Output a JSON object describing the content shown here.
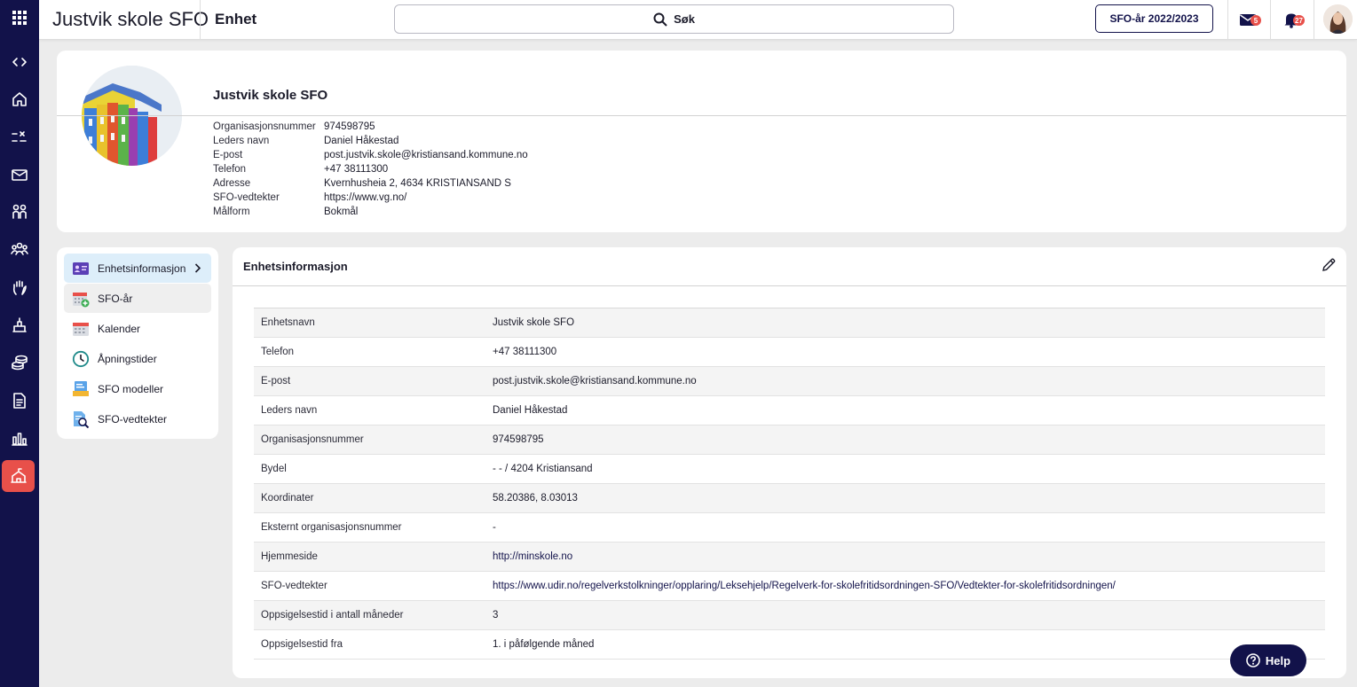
{
  "app": {
    "title": "Justvik skole SFO",
    "page_title": "Enhet"
  },
  "search": {
    "label": "Søk"
  },
  "header": {
    "year_button": "SFO-år 2022/2023",
    "messages_count": "5",
    "notifications_count": "27"
  },
  "rail": {
    "items": [
      "grid-icon",
      "expand-collapse-icon",
      "home-icon",
      "tasks-icon",
      "mail-icon",
      "people-icon",
      "groups-icon",
      "hand-icon",
      "building-icon",
      "coins-icon",
      "document-icon",
      "chart-icon",
      "school-icon"
    ],
    "active_item": "school-icon"
  },
  "profile": {
    "name": "Justvik skole SFO",
    "rows": [
      {
        "label": "Organisasjonsnummer",
        "value": "974598795"
      },
      {
        "label": "Leders navn",
        "value": "Daniel Håkestad"
      },
      {
        "label": "E-post",
        "value": "post.justvik.skole@kristiansand.kommune.no"
      },
      {
        "label": "Telefon",
        "value": "+47 38111300"
      },
      {
        "label": "Adresse",
        "value": "Kvernhusheia 2, 4634 KRISTIANSAND S"
      },
      {
        "label": "SFO-vedtekter",
        "value": "https://www.vg.no/"
      },
      {
        "label": "Målform",
        "value": "Bokmål"
      }
    ]
  },
  "menu": {
    "items": [
      {
        "label": "Enhetsinformasjon",
        "icon": "id-card-icon"
      },
      {
        "label": "SFO-år",
        "icon": "calendar-add-icon"
      },
      {
        "label": "Kalender",
        "icon": "calendar-icon"
      },
      {
        "label": "Åpningstider",
        "icon": "clock-icon"
      },
      {
        "label": "SFO modeller",
        "icon": "model-icon"
      },
      {
        "label": "SFO-vedtekter",
        "icon": "document-search-icon"
      }
    ],
    "selected": "Enhetsinformasjon"
  },
  "details": {
    "title": "Enhetsinformasjon",
    "rows": [
      {
        "label": "Enhetsnavn",
        "value": "Justvik skole SFO"
      },
      {
        "label": "Telefon",
        "value": "+47 38111300"
      },
      {
        "label": "E-post",
        "value": "post.justvik.skole@kristiansand.kommune.no"
      },
      {
        "label": "Leders navn",
        "value": "Daniel Håkestad"
      },
      {
        "label": "Organisasjonsnummer",
        "value": "974598795"
      },
      {
        "label": "Bydel",
        "value": "- - / 4204 Kristiansand"
      },
      {
        "label": "Koordinater",
        "value": "58.20386, 8.03013"
      },
      {
        "label": "Eksternt organisasjonsnummer",
        "value": "-"
      },
      {
        "label": "Hjemmeside",
        "value": "http://minskole.no"
      },
      {
        "label": "SFO-vedtekter",
        "value": "https://www.udir.no/regelverkstolkninger/opplaring/Leksehjelp/Regelverk-for-skolefritidsordningen-SFO/Vedtekter-for-skolefritidsordningen/"
      },
      {
        "label": "Oppsigelsestid i antall måneder",
        "value": "3"
      },
      {
        "label": "Oppsigelsestid fra",
        "value": "1. i påfølgende måned"
      }
    ]
  },
  "help": {
    "label": "Help"
  },
  "colors": {
    "navy": "#12124a",
    "accent_red": "#e8504a",
    "selected_bg": "#ddeefa"
  }
}
